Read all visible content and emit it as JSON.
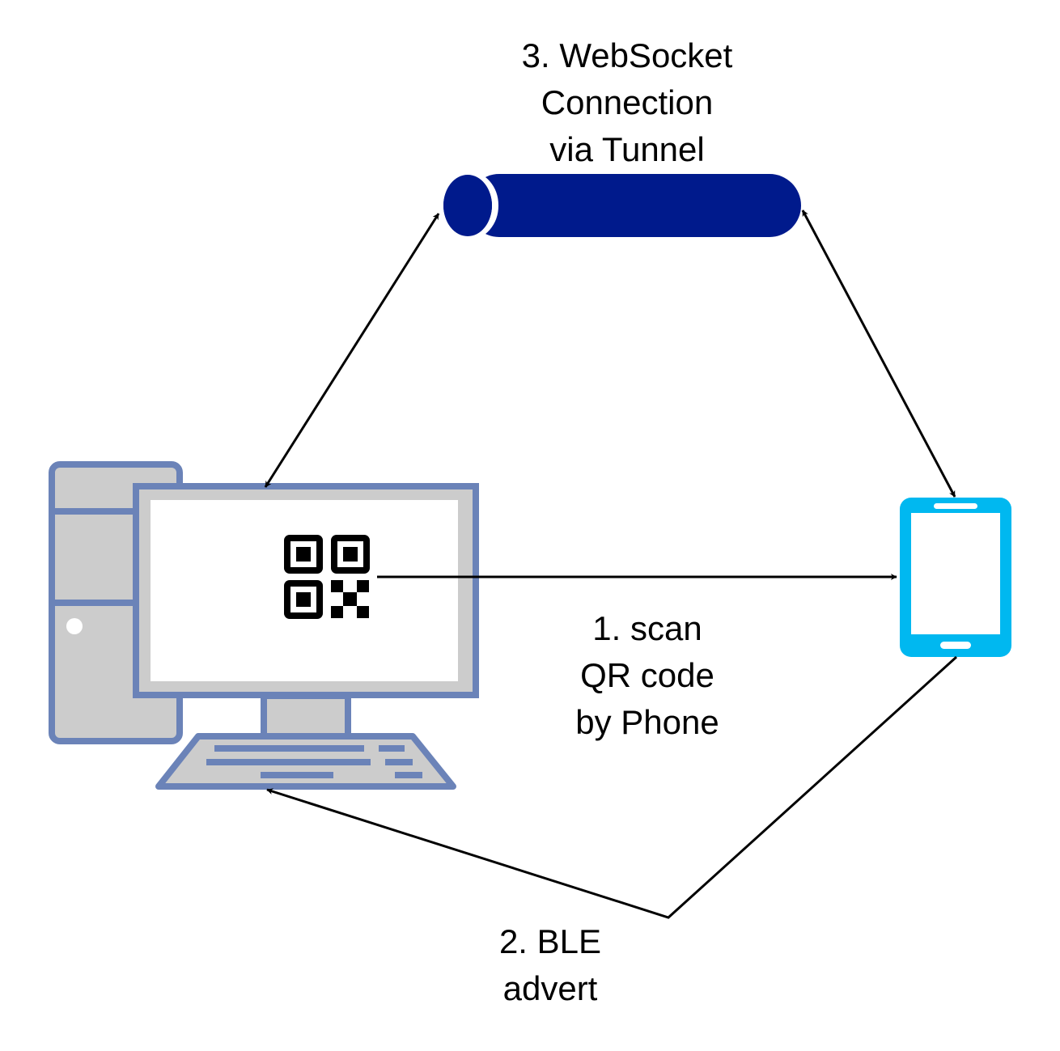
{
  "labels": {
    "tunnel": [
      "3. WebSocket",
      "Connection",
      "via Tunnel"
    ],
    "scan": [
      "1. scan",
      "QR code",
      "by Phone"
    ],
    "ble": [
      "2. BLE",
      "advert"
    ]
  },
  "icons": {
    "tunnel": "pipe-cylinder-icon",
    "computer": "desktop-computer-icon",
    "qr": "qr-code-icon",
    "phone": "mobile-phone-icon"
  },
  "colors": {
    "tunnel": "#001a8c",
    "computer_outline": "#6b83b8",
    "computer_fill": "#cccccc",
    "screen": "#ffffff",
    "phone": "#00b8f0",
    "qr": "#000000",
    "arrow": "#000000"
  }
}
